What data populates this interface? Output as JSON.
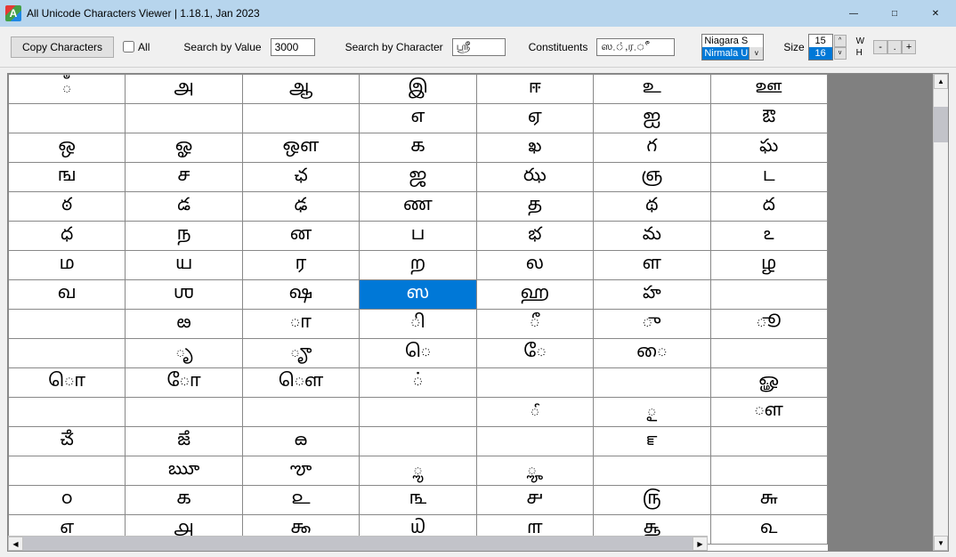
{
  "window": {
    "title": "All Unicode Characters Viewer | 1.18.1, Jan 2023"
  },
  "toolbar": {
    "copy_label": "Copy Characters",
    "all_label": "All",
    "search_value_label": "Search by Value",
    "search_value": "3000",
    "search_char_label": "Search by Character",
    "search_char": "ஸ்ரீ",
    "constituents_label": "Constituents",
    "constituents": "ஸ,்,ர,ீ",
    "font_options": [
      "Niagara S",
      "Nirmala U"
    ],
    "font_selected_index": 1,
    "size_label": "Size",
    "size_options": [
      "15",
      "16"
    ],
    "size_selected_index": 1,
    "w_label": "W",
    "h_label": "H",
    "minus": "-",
    "plus": "+",
    "dot": "."
  },
  "grid": {
    "cols": 7,
    "selected": {
      "row": 7,
      "col": 3
    },
    "rows": [
      [
        "ఀ",
        "அ",
        "ஆ",
        "இ",
        "ஈ",
        "உ",
        "ஊ"
      ],
      [
        "఍",
        "఑",
        "಍",
        "எ",
        "ஏ",
        "ஐ",
        "ఔ"
      ],
      [
        "ஒ",
        "ஓ",
        "ஔ",
        "க",
        "ఖ",
        "గ",
        "ఘ"
      ],
      [
        "ங",
        "ச",
        "ఛ",
        "ஜ",
        "ఝ",
        "ஞ",
        "ட"
      ],
      [
        "ఠ",
        "డ",
        "ఢ",
        "ண",
        "த",
        "థ",
        "ద"
      ],
      [
        "ధ",
        "ந",
        "ன",
        "ப",
        "భ",
        "మ",
        "ఽ"
      ],
      [
        "ம",
        "ய",
        "ர",
        "ற",
        "ல",
        "ள",
        "ழ"
      ],
      [
        "வ",
        "ஶ",
        "ஷ",
        "ஸ",
        "ஹ",
        "హ",
        "఺"
      ],
      [
        "఻",
        "ఴ",
        "ா",
        "ி",
        "ீ",
        "ு",
        "ூ"
      ],
      [
        "౅",
        "ృ",
        "ౄ",
        "ெ",
        "ே",
        "ை",
        "౉"
      ],
      [
        "ொ",
        "ோ",
        "ௌ",
        "்",
        "೉",
        "೥",
        "ௐ"
      ],
      [
        "೑",
        "೒",
        "౓",
        "౔",
        "ౕ",
        "ౖ",
        "ௗ"
      ],
      [
        "ౘ",
        "ౙ",
        "ౚ",
        "౛",
        "౜",
        "ౝ",
        "౞"
      ],
      [
        "౟",
        "ౠ",
        "ౡ",
        "ౢ",
        "ౣ",
        "౤",
        "౥"
      ],
      [
        "௦",
        "௧",
        "௨",
        "௩",
        "௪",
        "௫",
        "௬"
      ],
      [
        "௭",
        "௮",
        "௯",
        "௰",
        "௱",
        "௲",
        "௳"
      ]
    ]
  }
}
